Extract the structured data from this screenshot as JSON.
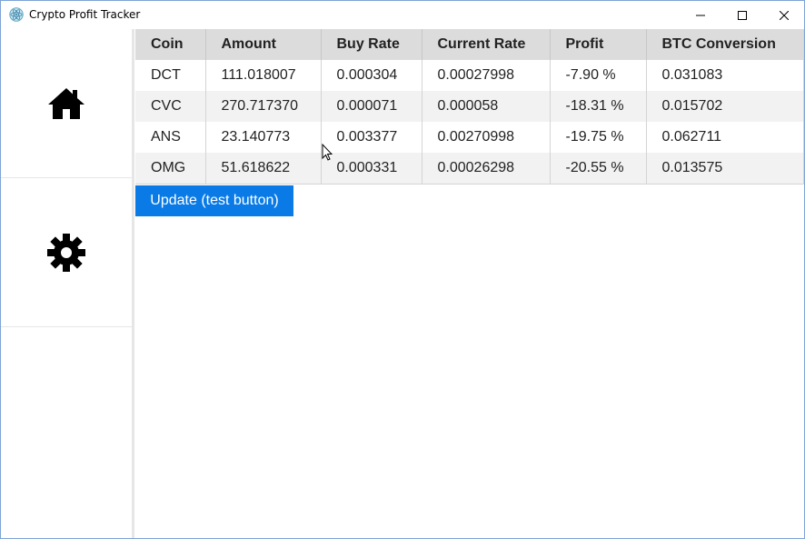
{
  "window": {
    "title": "Crypto Profit Tracker",
    "icon": "app-logo-icon",
    "controls": [
      "minimize-icon",
      "maximize-icon",
      "close-icon"
    ]
  },
  "sidebar": {
    "items": [
      {
        "name": "home",
        "icon": "home-icon"
      },
      {
        "name": "settings",
        "icon": "gear-icon"
      }
    ]
  },
  "table": {
    "headers": [
      "Coin",
      "Amount",
      "Buy Rate",
      "Current Rate",
      "Profit",
      "BTC Conversion"
    ],
    "rows": [
      [
        "DCT",
        "111.018007",
        "0.000304",
        "0.00027998",
        "-7.90 %",
        "0.031083"
      ],
      [
        "CVC",
        "270.717370",
        "0.000071",
        "0.000058",
        "-18.31 %",
        "0.015702"
      ],
      [
        "ANS",
        "23.140773",
        "0.003377",
        "0.00270998",
        "-19.75 %",
        "0.062711"
      ],
      [
        "OMG",
        "51.618622",
        "0.000331",
        "0.00026298",
        "-20.55 %",
        "0.013575"
      ]
    ]
  },
  "actions": {
    "update_label": "Update (test button)"
  },
  "colors": {
    "accent": "#0a7be6",
    "header_bg": "#dcdcdc",
    "row_alt": "#f2f2f2"
  }
}
